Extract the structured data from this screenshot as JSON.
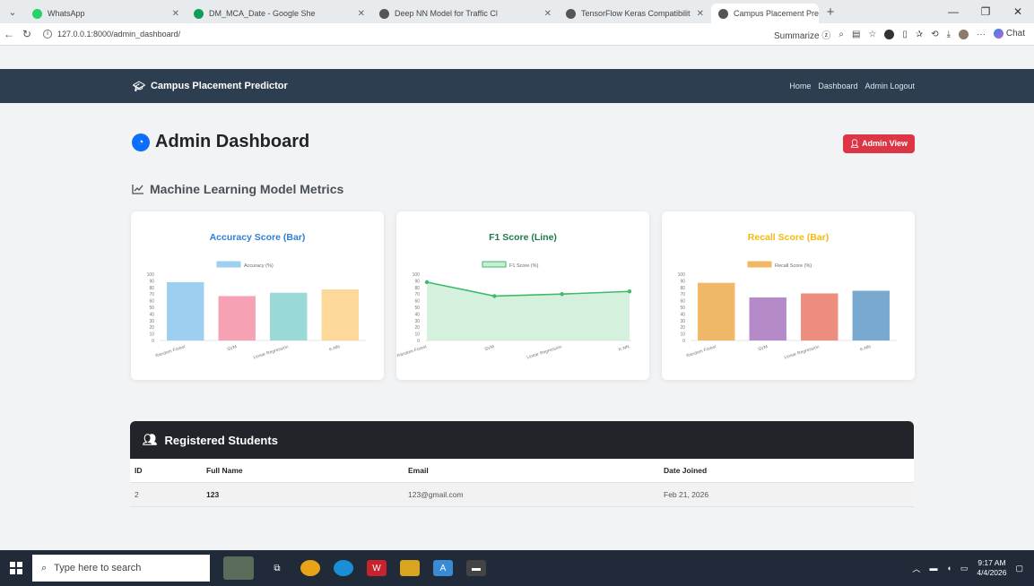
{
  "browser": {
    "tabs": [
      {
        "title": "WhatsApp",
        "color": "#25d366",
        "active": false
      },
      {
        "title": "DM_MCA_Date - Google She",
        "color": "#0f9d58",
        "active": false
      },
      {
        "title": "Deep NN Model for Traffic Cl",
        "color": "#555555",
        "active": false
      },
      {
        "title": "TensorFlow Keras Compatibilit",
        "color": "#555555",
        "active": false
      },
      {
        "title": "Campus Placement Predictor",
        "color": "#555555",
        "active": true
      }
    ],
    "url": "127.0.0.1:8000/admin_dashboard/",
    "summarize_label": "Summarize",
    "chat_label": "Chat"
  },
  "navbar": {
    "brand": "Campus Placement Predictor",
    "links": [
      "Home",
      "Dashboard",
      "Admin Logout"
    ]
  },
  "page": {
    "title": "Admin Dashboard",
    "badge": "Admin View",
    "section_title": "Machine Learning Model Metrics"
  },
  "charts": [
    {
      "title": "Accuracy Score (Bar)",
      "title_color": "#2f7fd8",
      "chart_data": {
        "type": "bar",
        "categories": [
          "Random Forest",
          "SVM",
          "Linear Regression",
          "K-NN"
        ],
        "series": [
          {
            "name": "Accuracy (%)",
            "values": [
              88,
              67,
              72,
              77
            ]
          }
        ],
        "ylim": [
          0,
          100
        ],
        "yticks": [
          "100",
          "90",
          "80",
          "70",
          "60",
          "50",
          "40",
          "30",
          "20",
          "10",
          "0"
        ],
        "colors": [
          "#9ccff0",
          "#f7a1b4",
          "#9ad9d6",
          "#fcd99a"
        ],
        "legend_color": "#9ccff0"
      }
    },
    {
      "title": "F1 Score (Line)",
      "title_color": "#1e7a4c",
      "chart_data": {
        "type": "line",
        "categories": [
          "Random Forest",
          "SVM",
          "Linear Regression",
          "K-NN"
        ],
        "series": [
          {
            "name": "F1 Score (%)",
            "values": [
              88,
              67,
              70,
              74
            ]
          }
        ],
        "ylim": [
          0,
          100
        ],
        "yticks": [
          "100",
          "90",
          "80",
          "70",
          "60",
          "50",
          "40",
          "30",
          "20",
          "10",
          "0"
        ],
        "line_color": "#3fba6a",
        "fill_color": "#c9eed5"
      }
    },
    {
      "title": "Recall Score (Bar)",
      "title_color": "#f2b90f",
      "chart_data": {
        "type": "bar",
        "categories": [
          "Random Forest",
          "SVM",
          "Linear Regression",
          "K-NN"
        ],
        "series": [
          {
            "name": "Recall Score (%)",
            "values": [
              87,
              65,
              71,
              75
            ]
          }
        ],
        "ylim": [
          0,
          100
        ],
        "yticks": [
          "100",
          "90",
          "80",
          "70",
          "60",
          "50",
          "40",
          "30",
          "20",
          "10",
          "0"
        ],
        "colors": [
          "#f0b866",
          "#b48ac8",
          "#ec8d80",
          "#7aa9d0"
        ],
        "legend_color": "#f0b866"
      }
    }
  ],
  "students": {
    "heading": "Registered Students",
    "columns": [
      "ID",
      "Full Name",
      "Email",
      "Date Joined"
    ],
    "rows": [
      {
        "id": "2",
        "name": "123",
        "email": "123@gmail.com",
        "date": "Feb 21, 2026"
      }
    ]
  },
  "taskbar": {
    "search_placeholder": "Type here to search",
    "time": "9:17 AM",
    "date": "4/4/2026"
  }
}
